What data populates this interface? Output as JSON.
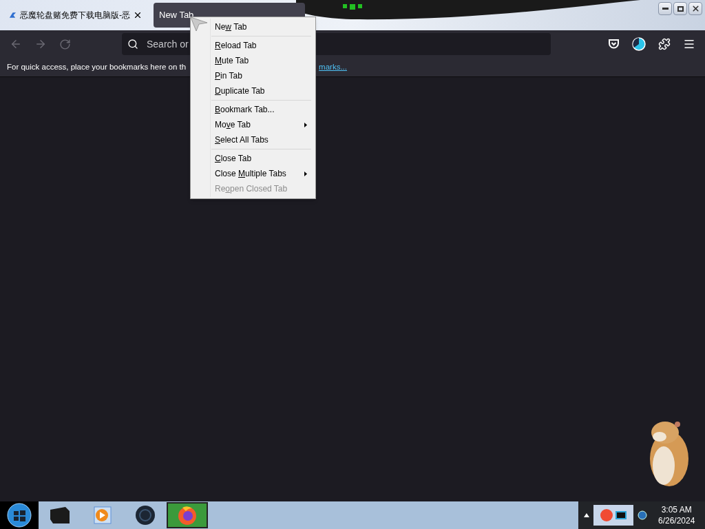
{
  "tabs": [
    {
      "title": "恶魔轮盘赌免费下载电脑版-恶",
      "selected": false
    },
    {
      "title": "New Tab",
      "selected": true
    }
  ],
  "toolbar": {
    "search_placeholder": "Search or"
  },
  "bookmarks_bar": {
    "message": "For quick access, place your bookmarks here on th",
    "link": "marks..."
  },
  "context_menu": [
    {
      "kind": "item",
      "before": "Ne",
      "key": "w",
      "after": " Tab",
      "submenu": false,
      "disabled": false
    },
    {
      "kind": "separator"
    },
    {
      "kind": "item",
      "key": "R",
      "after": "eload Tab",
      "submenu": false,
      "disabled": false
    },
    {
      "kind": "item",
      "key": "M",
      "after": "ute Tab",
      "submenu": false,
      "disabled": false
    },
    {
      "kind": "item",
      "key": "P",
      "after": "in Tab",
      "submenu": false,
      "disabled": false
    },
    {
      "kind": "item",
      "key": "D",
      "after": "uplicate Tab",
      "submenu": false,
      "disabled": false
    },
    {
      "kind": "separator"
    },
    {
      "kind": "item",
      "key": "B",
      "after": "ookmark Tab...",
      "submenu": false,
      "disabled": false
    },
    {
      "kind": "item",
      "before": "Mo",
      "key": "v",
      "after": "e Tab",
      "submenu": true,
      "disabled": false
    },
    {
      "kind": "item",
      "key": "S",
      "after": "elect All Tabs",
      "submenu": false,
      "disabled": false
    },
    {
      "kind": "separator"
    },
    {
      "kind": "item",
      "key": "C",
      "after": "lose Tab",
      "submenu": false,
      "disabled": false
    },
    {
      "kind": "item",
      "before": "Close ",
      "key": "M",
      "after": "ultiple Tabs",
      "submenu": true,
      "disabled": false
    },
    {
      "kind": "item",
      "before": "Re",
      "key": "o",
      "after": "pen Closed Tab",
      "submenu": false,
      "disabled": true
    }
  ],
  "taskbar": {
    "time": "3:05 AM",
    "date": "6/26/2024"
  }
}
